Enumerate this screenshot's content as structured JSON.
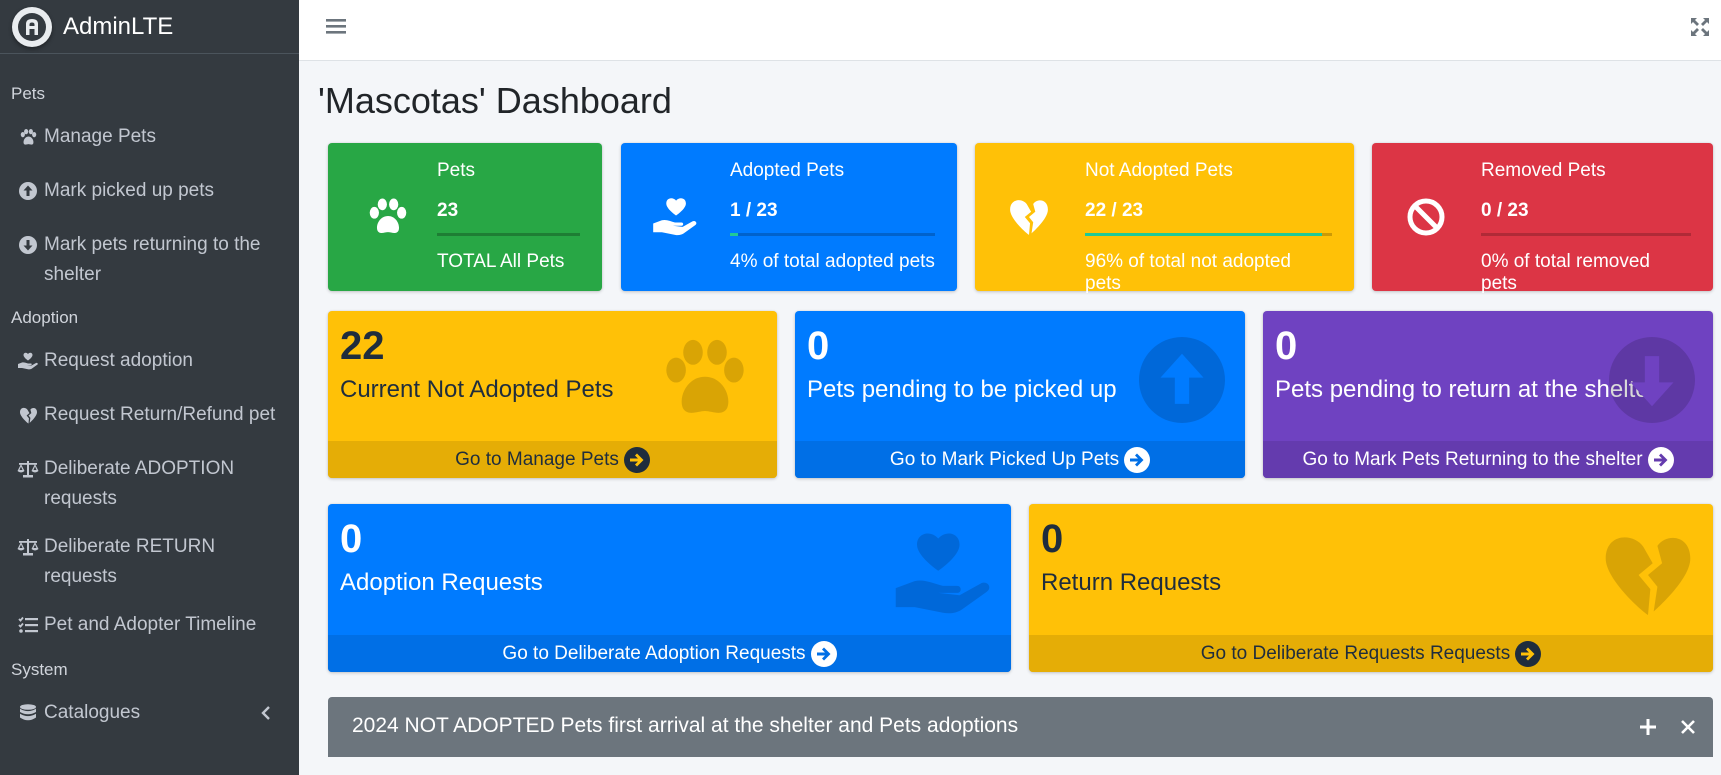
{
  "brand": {
    "name_bold": "Admin",
    "name_light": "LTE"
  },
  "sidebar": {
    "sections": [
      {
        "header": "Pets",
        "items": [
          {
            "label": "Manage Pets",
            "icon": "paw-icon"
          },
          {
            "label": "Mark picked up pets",
            "icon": "arrow-circle-up-icon"
          },
          {
            "label": "Mark pets returning to the shelter",
            "icon": "arrow-circle-down-icon"
          }
        ]
      },
      {
        "header": "Adoption",
        "items": [
          {
            "label": "Request adoption",
            "icon": "hand-holding-heart-icon"
          },
          {
            "label": "Request Return/Refund pet",
            "icon": "heart-broken-icon"
          },
          {
            "label": "Deliberate ADOPTION requests",
            "icon": "balance-scale-icon"
          },
          {
            "label": "Deliberate RETURN requests",
            "icon": "balance-scale-icon"
          },
          {
            "label": "Pet and Adopter Timeline",
            "icon": "tasks-icon"
          }
        ]
      },
      {
        "header": "System",
        "items": [
          {
            "label": "Catalogues",
            "icon": "database-icon"
          }
        ]
      }
    ]
  },
  "page_title": "'Mascotas' Dashboard",
  "info_boxes": [
    {
      "label": "Pets",
      "number": "23",
      "progress": 1.0,
      "desc": "TOTAL All Pets",
      "color": "#28a745",
      "icon": "paw-icon"
    },
    {
      "label": "Adopted Pets",
      "number": "1 / 23",
      "progress": 0.04,
      "desc": "4% of total adopted pets",
      "color": "#007bff",
      "icon": "hand-holding-heart-icon"
    },
    {
      "label": "Not Adopted Pets",
      "number": "22 / 23",
      "progress": 0.96,
      "desc": "96% of total not adopted pets",
      "color": "#ffc107",
      "icon": "heart-broken-icon"
    },
    {
      "label": "Removed Pets",
      "number": "0 / 23",
      "progress": 0.0,
      "desc": "0% of total removed pets",
      "color": "#dc3545",
      "icon": "ban-icon"
    }
  ],
  "small_boxes": [
    {
      "number": "22",
      "text": "Current Not Adopted Pets",
      "footer": "Go to Manage Pets",
      "color": "#ffc107",
      "footer_color": "#e5ad06",
      "icon": "paw-icon"
    },
    {
      "number": "0",
      "text": "Pets pending to be picked up",
      "footer": "Go to Mark Picked Up Pets",
      "color": "#007bff",
      "footer_color": "#006fe6",
      "icon": "arrow-circle-up-icon"
    },
    {
      "number": "0",
      "text": "Pets pending to return at the shelter",
      "footer": "Go to Mark Pets Returning to the shelter",
      "color": "#6f42c1",
      "footer_color": "#643bae",
      "icon": "arrow-circle-down-icon"
    },
    {
      "number": "0",
      "text": "Adoption Requests",
      "footer": "Go to Deliberate Adoption Requests",
      "color": "#007bff",
      "footer_color": "#006fe6",
      "icon": "hand-holding-heart-icon"
    },
    {
      "number": "0",
      "text": "Return Requests",
      "footer": "Go to Deliberate Requests Requests",
      "color": "#ffc107",
      "footer_color": "#e5ad06",
      "icon": "heart-broken-icon"
    }
  ],
  "card": {
    "title": "2024 NOT ADOPTED Pets first arrival at the shelter and Pets adoptions"
  }
}
